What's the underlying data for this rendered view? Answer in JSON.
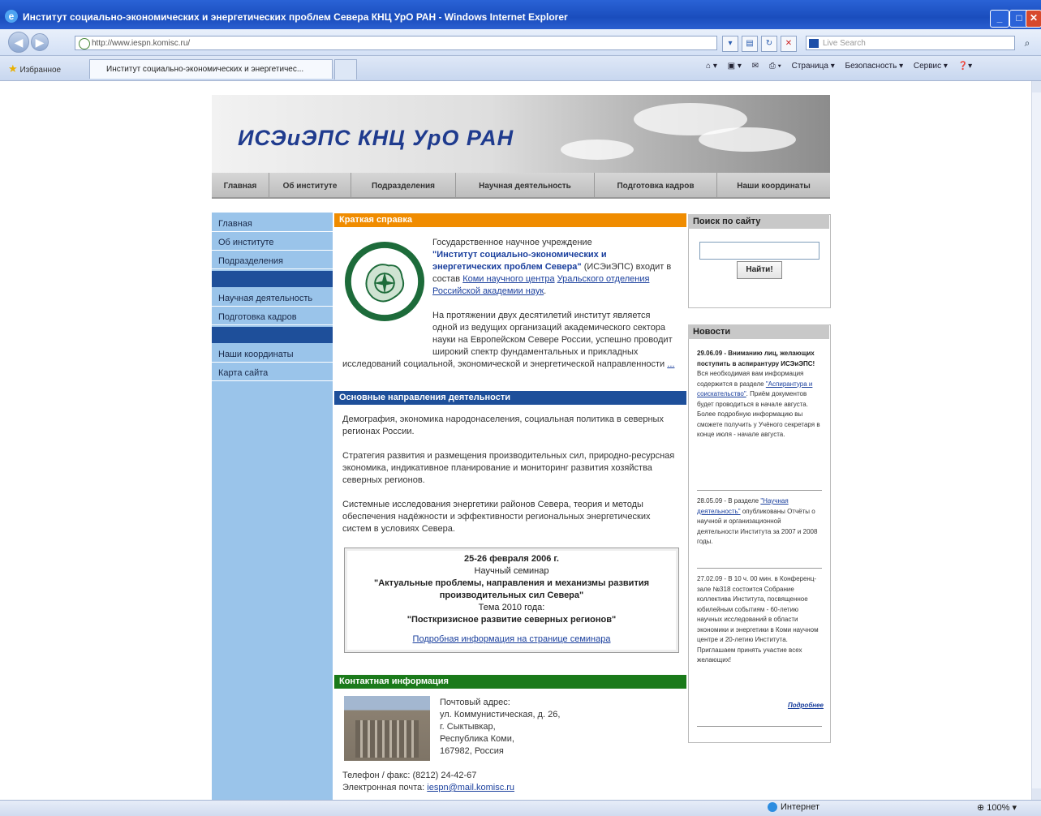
{
  "browser": {
    "window_title": "Институт социально-экономических и энергетических проблем Севера КНЦ УрО РАН - Windows Internet Explorer",
    "url": "http://www.iespn.komisc.ru/",
    "search_placeholder": "Live Search",
    "favorites_label": "Избранное",
    "tab_label": "Институт социально-экономических и энергетичес...",
    "cmd_page": "Страница ▾",
    "cmd_security": "Безопасность ▾",
    "cmd_service": "Сервис ▾",
    "status_zone": "Интернет",
    "zoom": "100%"
  },
  "site": {
    "banner_title": "ИСЭиЭПС КНЦ УрО РАН",
    "top_nav": [
      "Главная",
      "Об институте",
      "Подразделения",
      "Научная деятельность",
      "Подготовка кадров",
      "Наши координаты"
    ],
    "left_menu": {
      "main": "Главная",
      "about": "Об институте",
      "divisions": "Подразделения",
      "science": "Научная деятельность",
      "training": "Подготовка кадров",
      "coords": "Наши координаты",
      "sitemap": "Карта сайта"
    }
  },
  "brief": {
    "heading": "Краткая справка",
    "p1_a": "Государственное научное учреждение",
    "p1_bold": "\"Институт социально-экономических и энергетических проблем Севера\"",
    "p1_b": " (ИСЭиЭПС) входит в состав ",
    "link_komi": "Коми научного центра",
    "link_ural": "Уральского отделения",
    "link_ras": "Российской академии наук",
    "p2": "На протяжении двух десятилетий институт является одной из ведущих организаций академического сектора науки на Европейском Севере России, успешно проводит широкий спектр фундаментальных и прикладных исследований социальной, экономической и энергетической направленности",
    "more_link": "..."
  },
  "directions": {
    "heading": "Основные направления деятельности",
    "p1": "Демография, экономика народонаселения, социальная политика в северных регионах России.",
    "p2": "Стратегия развития и размещения производительных сил, природно-ресурсная экономика, индикативное планирование и мониторинг развития хозяйства северных регионов.",
    "p3": "Системные исследования энергетики районов Севера, теория и методы обеспечения надёжности и эффективности региональных энергетических систем в условиях Севера."
  },
  "seminar": {
    "date": "25-26 февраля 2006 г.",
    "type": "Научный семинар",
    "title": "\"Актуальные проблемы, направления и механизмы развития производительных сил Севера\"",
    "theme_label": "Тема 2010 года:",
    "theme": "\"Посткризисное развитие северных регионов\"",
    "link": "Подробная информация на странице семинара"
  },
  "contacts": {
    "heading": "Контактная информация",
    "address_label": "Почтовый адрес:",
    "street": "ул. Коммунистическая, д. 26,",
    "city": "г. Сыктывкар,",
    "republic": "Республика Коми,",
    "zip_country": "167982, Россия",
    "phone": "Телефон / факс: (8212) 24-42-67",
    "email_label": "Электронная почта: ",
    "email": "iespn@mail.komisc.ru"
  },
  "search_box": {
    "heading": "Поиск по сайту",
    "button": "Найти!"
  },
  "news": {
    "heading": "Новости",
    "item1_date": "29.06.09 - Вниманию лиц, желающих поступить в аспирантуру ИСЭиЭПС!",
    "item1_text_a": " Вся необходимая вам информация содержится в разделе ",
    "item1_link": "\"Аспирантура и соискательство\"",
    "item1_text_b": ". Приём документов будет проводиться в начале августа. Более подробную информацию вы сможете получить у Учёного секретаря в конце июля - начале августа.",
    "item2_a": "28.05.09 - В разделе ",
    "item2_link": "\"Научная деятельность\"",
    "item2_b": " опубликованы Отчёты о научной и организационной деятельности Института за 2007 и 2008 годы.",
    "item3": "27.02.09 - В 10 ч. 00 мин. в Конференц-зале №318 состоится Собрание коллектива Института, посвященное юбилейным событиям - 60-летию научных исследований в области экономики и энергетики в Коми научном центре и 20-летию Института. Приглашаем принять участие всех желающих!",
    "more": "Подробнее"
  }
}
